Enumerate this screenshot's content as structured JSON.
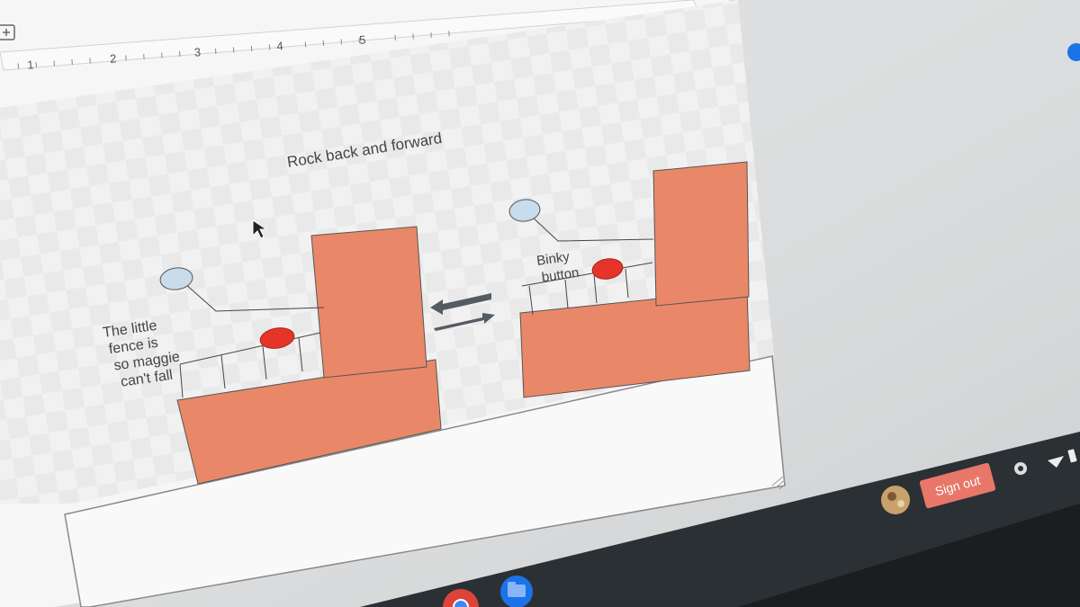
{
  "drawing": {
    "title_label": "Rock back and forward",
    "fence_note": [
      "The little",
      "fence is",
      "so maggie",
      "can't fall"
    ],
    "binky_note": [
      "Binky",
      "button"
    ]
  },
  "ruler": {
    "ticks": [
      "1",
      "2",
      "3",
      "4",
      "5"
    ]
  },
  "shelf": {
    "sign_out_label": "Sign out"
  },
  "icons": {
    "cursor": "mouse-pointer-icon",
    "equilibrium": "equilibrium-arrows-icon",
    "chrome": "chrome-icon",
    "files": "files-icon",
    "settings": "gear-icon",
    "wifi": "wifi-icon",
    "battery": "battery-icon",
    "resize": "resize-grip-icon"
  },
  "colors": {
    "block": "#e98868",
    "button": "#e63528",
    "bubble": "#c9dcec",
    "shelf": "#2b3034",
    "sign_out": "#e8776a",
    "arrows": "#555b63"
  }
}
